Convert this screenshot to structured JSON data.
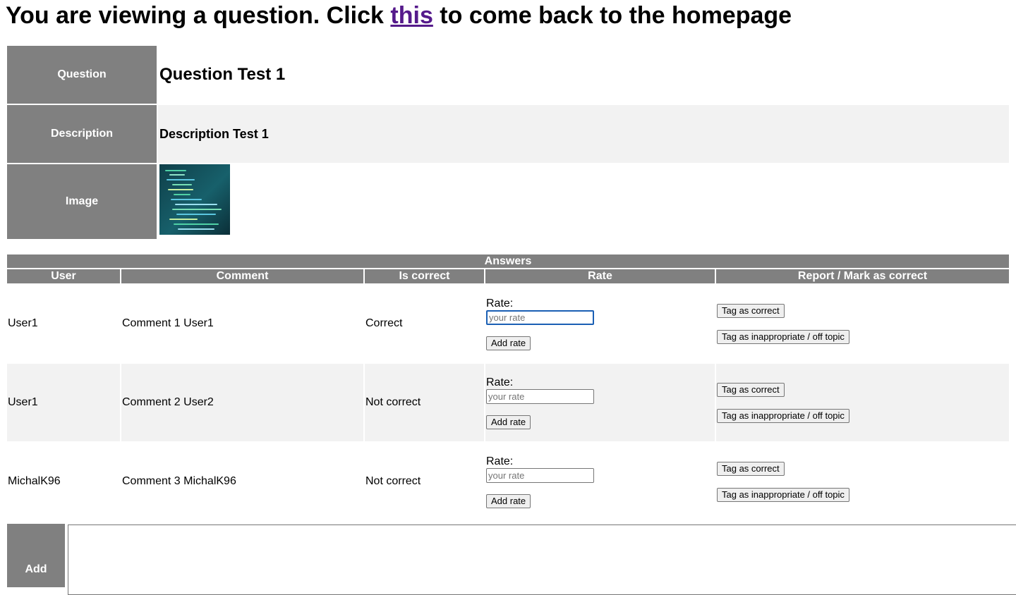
{
  "header": {
    "prefix": "You are viewing a question. Click ",
    "link_text": "this",
    "suffix": " to come back to the homepage"
  },
  "question": {
    "question_label": "Question",
    "question_value": "Question Test 1",
    "description_label": "Description",
    "description_value": "Description Test 1",
    "image_label": "Image"
  },
  "answers": {
    "caption": "Answers",
    "columns": [
      "User",
      "Comment",
      "Is correct",
      "Rate",
      "Report / Mark as correct"
    ],
    "rows": [
      {
        "user": "User1",
        "comment": "Comment 1 User1",
        "correct": "Correct"
      },
      {
        "user": "User1",
        "comment": "Comment 2 User2",
        "correct": "Not correct"
      },
      {
        "user": "MichalK96",
        "comment": "Comment 3 MichalK96",
        "correct": "Not correct"
      }
    ],
    "rate_label": "Rate:",
    "rate_placeholder": "your rate",
    "add_rate_label": "Add rate",
    "tag_correct_label": "Tag as correct",
    "tag_inappropriate_label": "Tag as inappropriate / off topic"
  },
  "add_section": {
    "label": "Add"
  },
  "colors": {
    "header_bg": "#808080",
    "alt_row_bg": "#f2f2f2",
    "link_visited": "#551a8b"
  }
}
